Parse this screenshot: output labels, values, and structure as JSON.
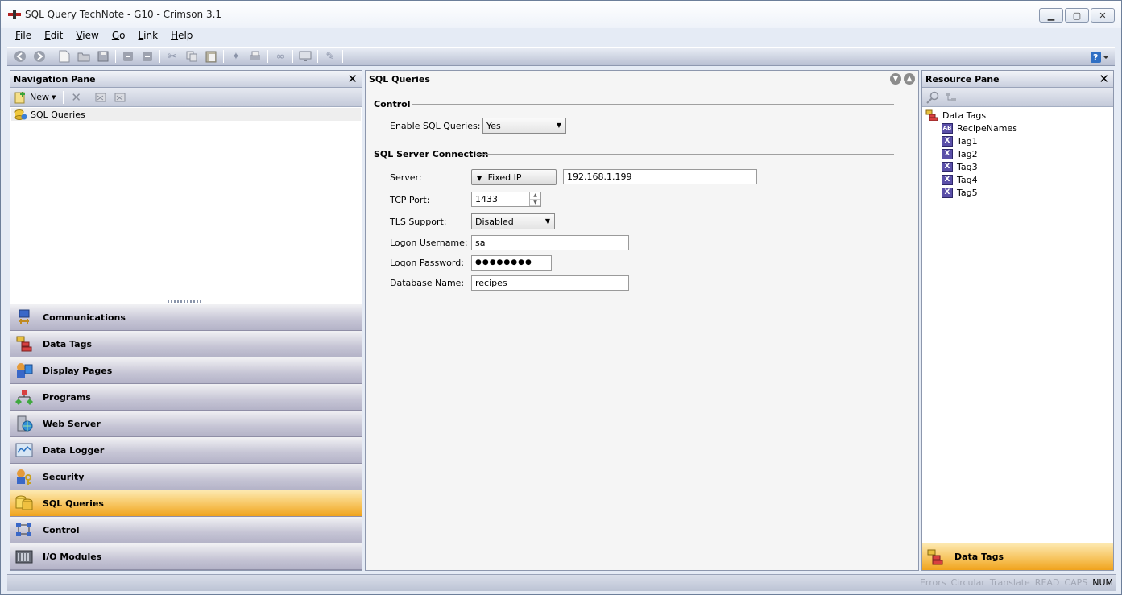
{
  "window": {
    "title": "SQL Query TechNote - G10 - Crimson 3.1",
    "minimize": "▁",
    "maximize": "▢",
    "close": "✕"
  },
  "menu": [
    {
      "key": "F",
      "rest": "ile"
    },
    {
      "key": "E",
      "rest": "dit"
    },
    {
      "key": "V",
      "rest": "iew"
    },
    {
      "key": "G",
      "rest": "o"
    },
    {
      "key": "L",
      "rest": "ink"
    },
    {
      "key": "H",
      "rest": "elp"
    }
  ],
  "nav": {
    "title": "Navigation Pane",
    "new_label": "New",
    "tree_item": "SQL Queries",
    "buttons": [
      "Communications",
      "Data Tags",
      "Display Pages",
      "Programs",
      "Web Server",
      "Data Logger",
      "Security",
      "SQL Queries",
      "Control",
      "I/O Modules"
    ],
    "active": "SQL Queries"
  },
  "main": {
    "title": "SQL Queries",
    "control": {
      "group": "Control",
      "enable_label": "Enable SQL Queries:",
      "enable_value": "Yes"
    },
    "connection": {
      "group": "SQL Server Connection",
      "server_label": "Server:",
      "server_mode": "Fixed IP",
      "server_ip": "192.168.1.199",
      "port_label": "TCP Port:",
      "port_value": "1433",
      "tls_label": "TLS Support:",
      "tls_value": "Disabled",
      "user_label": "Logon Username:",
      "user_value": "sa",
      "pass_label": "Logon Password:",
      "pass_value": "●●●●●●●●",
      "db_label": "Database Name:",
      "db_value": "recipes"
    }
  },
  "resource": {
    "title": "Resource Pane",
    "root": "Data Tags",
    "tags": [
      {
        "badge": "AB",
        "name": "RecipeNames"
      },
      {
        "badge": "X",
        "name": "Tag1"
      },
      {
        "badge": "X",
        "name": "Tag2"
      },
      {
        "badge": "X",
        "name": "Tag3"
      },
      {
        "badge": "X",
        "name": "Tag4"
      },
      {
        "badge": "X",
        "name": "Tag5"
      }
    ],
    "bottom_button": "Data Tags"
  },
  "status": {
    "items": [
      "Errors",
      "Circular",
      "Translate",
      "READ",
      "CAPS",
      "NUM"
    ],
    "active": "NUM"
  },
  "colors": {
    "active_tab": "#f0a31d",
    "pane_border": "#8d97ad",
    "tag_badge": "#5a4fa8"
  }
}
